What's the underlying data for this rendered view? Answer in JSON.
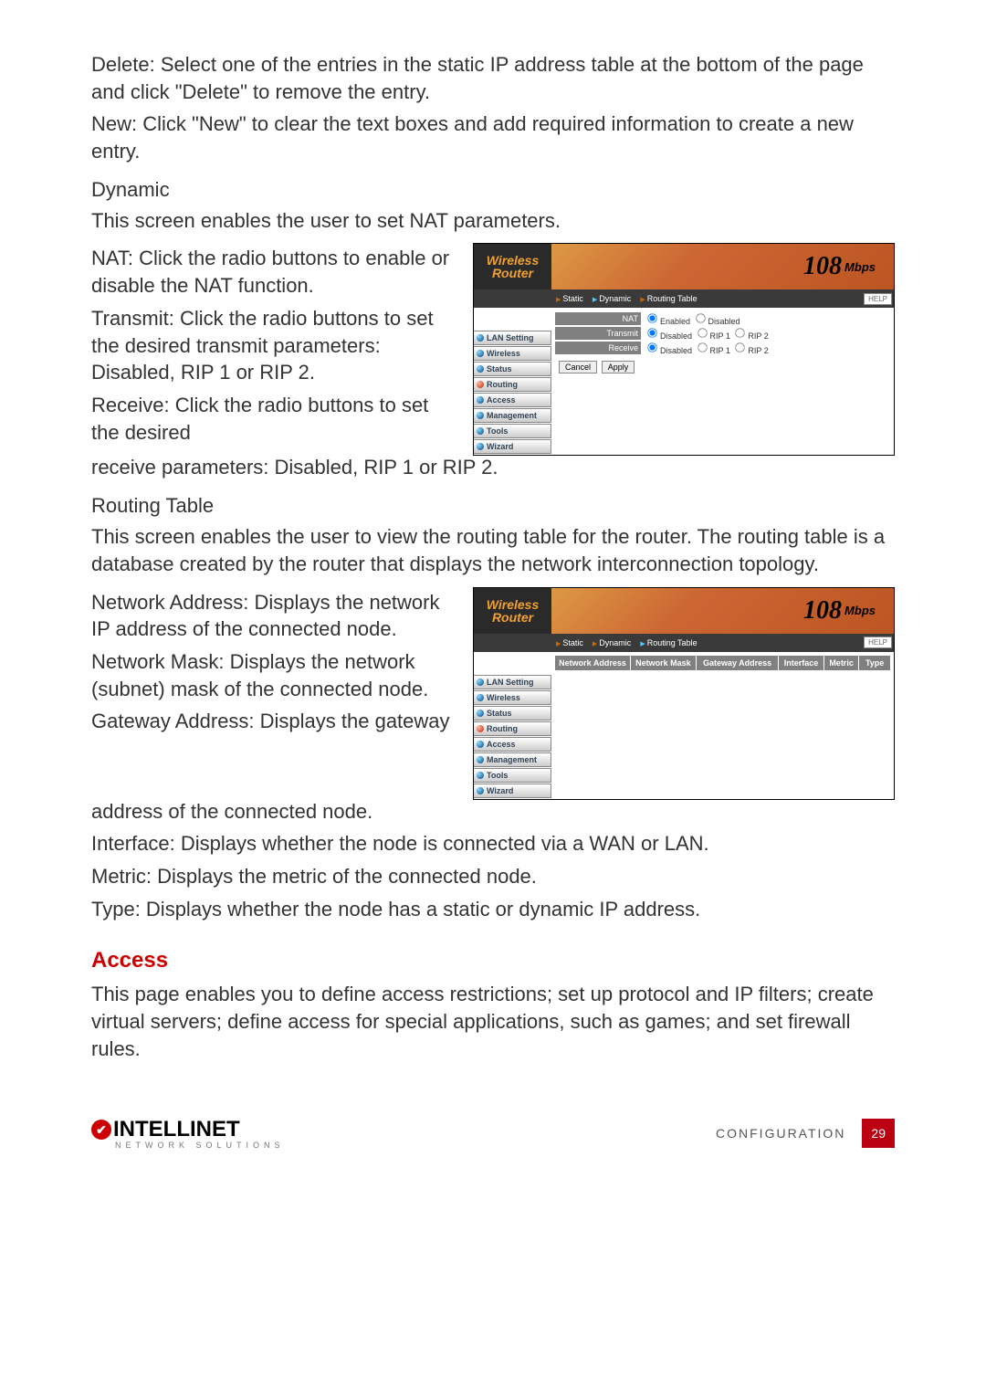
{
  "para": {
    "delete": "Delete: Select one of the entries in the static IP address table at the bottom of the page and click \"Delete\" to remove the entry.",
    "newpara": "New: Click \"New\" to clear the text boxes and add required information to create a new entry.",
    "dynamic_intro": "This screen enables the user to set NAT parameters.",
    "nat": "NAT: Click the radio buttons to enable or disable the NAT function.",
    "transmit": "Transmit: Click the radio buttons to set the desired transmit parameters: Disabled, RIP 1 or RIP 2.",
    "receive_a": "Receive: Click the radio buttons to set the desired",
    "receive_b": "receive parameters: Disabled, RIP 1 or RIP 2.",
    "rt_intro": "This screen enables the user to view the routing table for the router. The routing table is a database created by the router that displays the network interconnection topology.",
    "netaddr": "Network Address: Displays the network IP address of the connected node.",
    "netmask": "Network Mask: Displays the network (subnet) mask of the connected node.",
    "gwaddr_a": "Gateway Address: Displays the gateway",
    "gwaddr_b": "address of the connected node.",
    "iface": "Interface: Displays whether the node is connected via a WAN or LAN.",
    "metric": "Metric: Displays the metric of the connected node.",
    "type": "Type: Displays whether the node has a static or dynamic IP address.",
    "access_intro": "This page enables you to define access restrictions; set up protocol and IP filters; create virtual servers; define access for special applications, such as games; and set firewall rules."
  },
  "heading": {
    "dynamic": "Dynamic",
    "routing_table": "Routing Table",
    "access": "Access"
  },
  "shot": {
    "brand_top": "Wireless",
    "brand_bottom": "Router",
    "rate_big": "108",
    "rate_small": "Mbps",
    "help": "HELP",
    "tabs": {
      "static": "Static",
      "dynamic": "Dynamic",
      "routing_table": "Routing Table"
    },
    "sidebar": {
      "lan": "LAN Setting",
      "wireless": "Wireless",
      "status": "Status",
      "routing": "Routing",
      "access": "Access",
      "management": "Management",
      "tools": "Tools",
      "wizard": "Wizard"
    }
  },
  "dyn_form": {
    "nat_label": "NAT",
    "nat_opts": {
      "enabled": "Enabled",
      "disabled": "Disabled"
    },
    "transmit_label": "Transmit",
    "transmit_opts": {
      "disabled": "Disabled",
      "rip1": "RIP 1",
      "rip2": "RIP 2"
    },
    "receive_label": "Receive",
    "receive_opts": {
      "disabled": "Disabled",
      "rip1": "RIP 1",
      "rip2": "RIP 2"
    },
    "cancel": "Cancel",
    "apply": "Apply"
  },
  "rt_cols": {
    "c1": "Network Address",
    "c2": "Network Mask",
    "c3": "Gateway Address",
    "c4": "Interface",
    "c5": "Metric",
    "c6": "Type"
  },
  "footer": {
    "brand": "INTELLINET",
    "sub": "NETWORK SOLUTIONS",
    "section": "CONFIGURATION",
    "page": "29"
  }
}
